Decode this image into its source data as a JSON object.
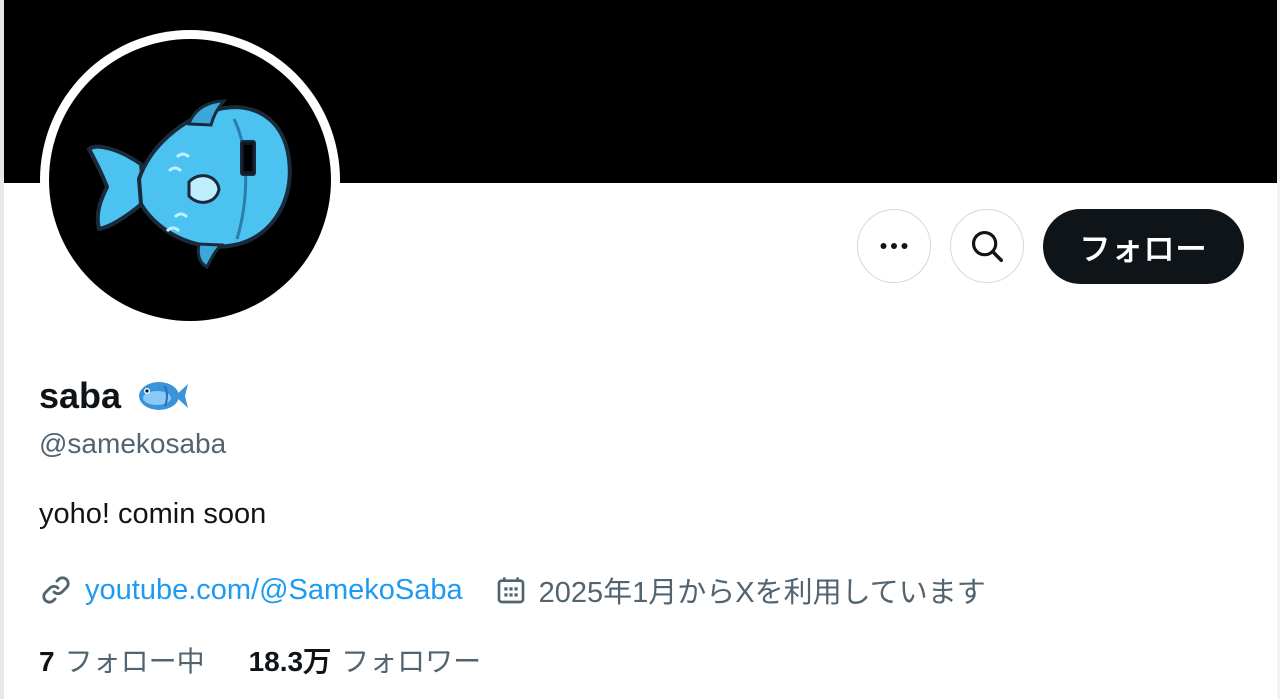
{
  "profile": {
    "display_name": "saba",
    "name_emoji": "fish-emoji",
    "handle": "@samekosaba",
    "bio": "yoho! comin soon",
    "link": "youtube.com/@SamekoSaba",
    "joined": "2025年1月からXを利用しています"
  },
  "actions": {
    "more_icon": "more-icon",
    "search_icon": "search-icon",
    "follow_label": "フォロー"
  },
  "stats": {
    "following_count": "7",
    "following_label": "フォロー中",
    "followers_count": "18.3万",
    "followers_label": "フォロワー"
  },
  "colors": {
    "banner": "#000000",
    "link": "#1d9bf0",
    "muted": "#536471",
    "avatar_fish": "#4cc2f0"
  }
}
